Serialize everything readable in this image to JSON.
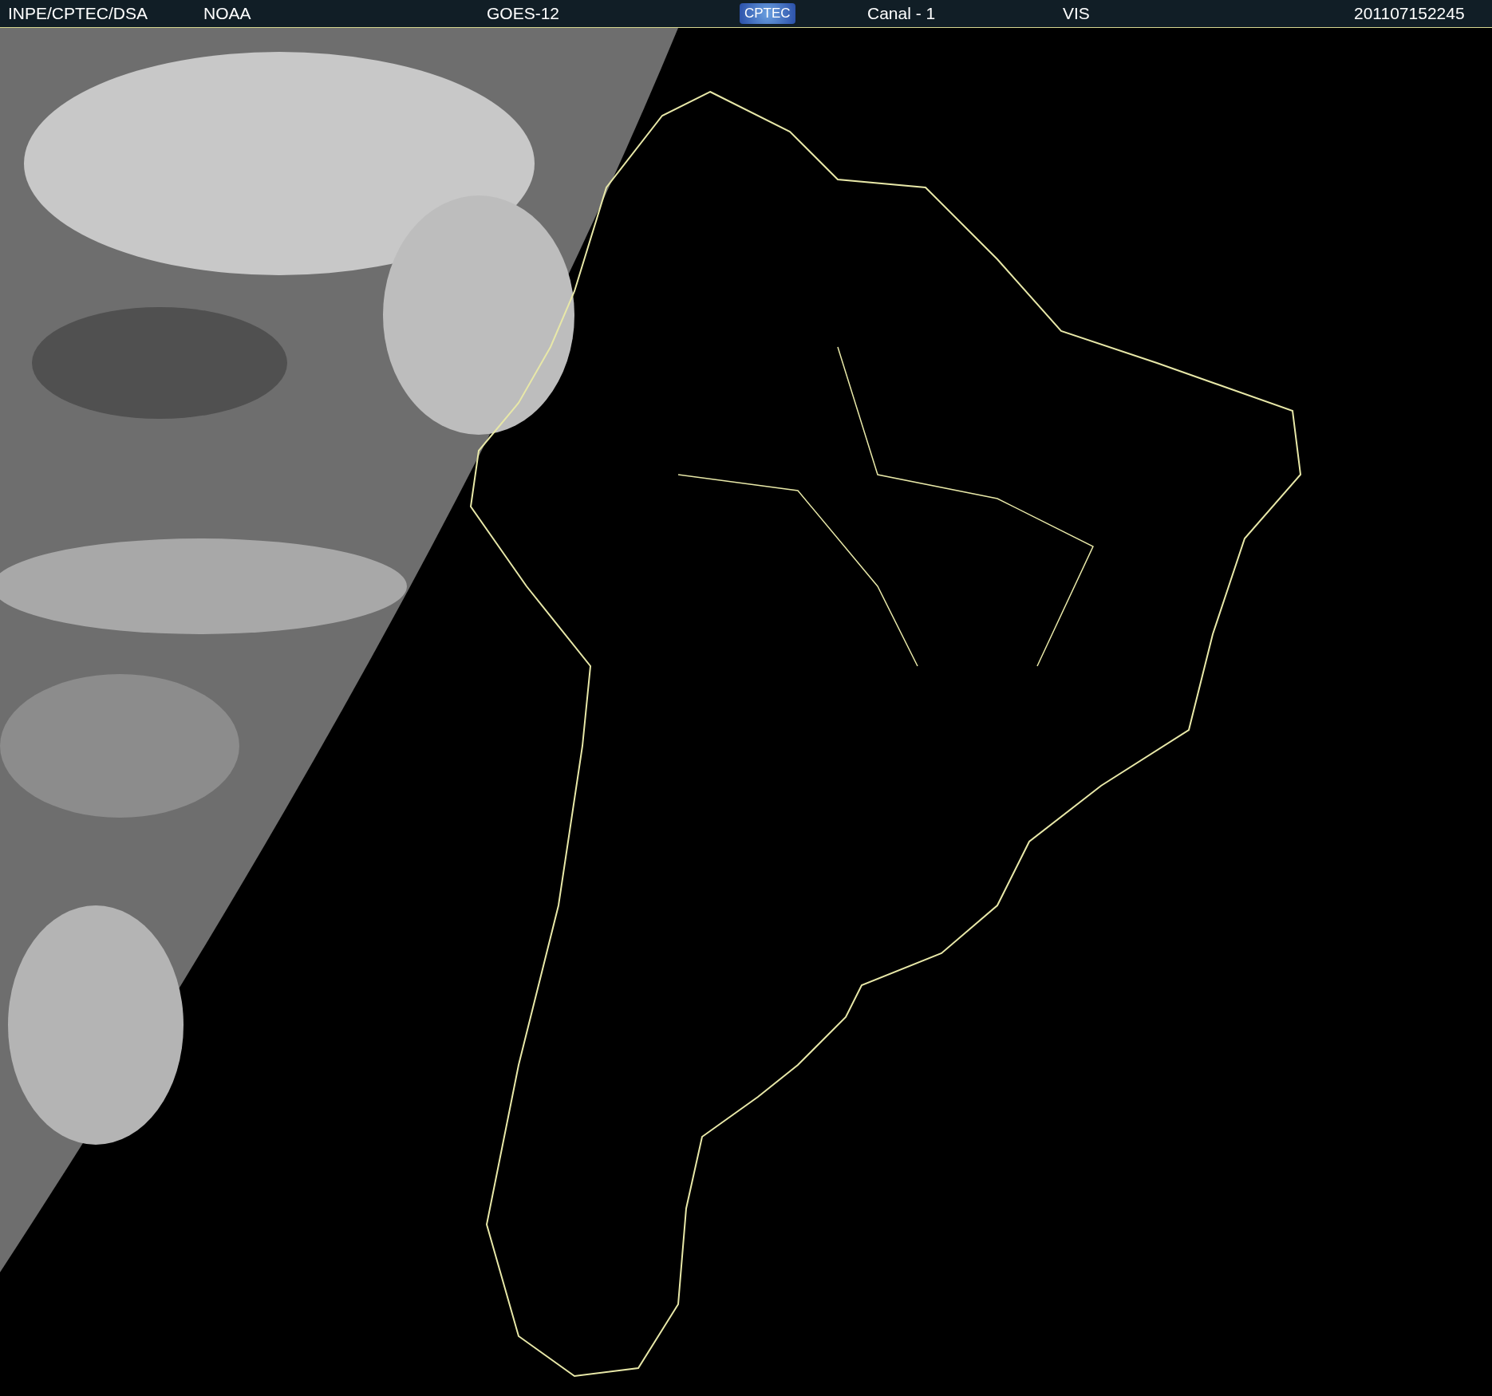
{
  "header": {
    "items": [
      {
        "kind": "text",
        "text": "INPE/CPTEC/DSA"
      },
      {
        "kind": "text",
        "text": "NOAA"
      },
      {
        "kind": "text",
        "text": "GOES-12"
      },
      {
        "kind": "logo",
        "text": "CPTEC"
      },
      {
        "kind": "text",
        "text": "Canal - 1"
      },
      {
        "kind": "text",
        "text": "VIS"
      },
      {
        "kind": "text",
        "text": "201107152245"
      }
    ]
  }
}
